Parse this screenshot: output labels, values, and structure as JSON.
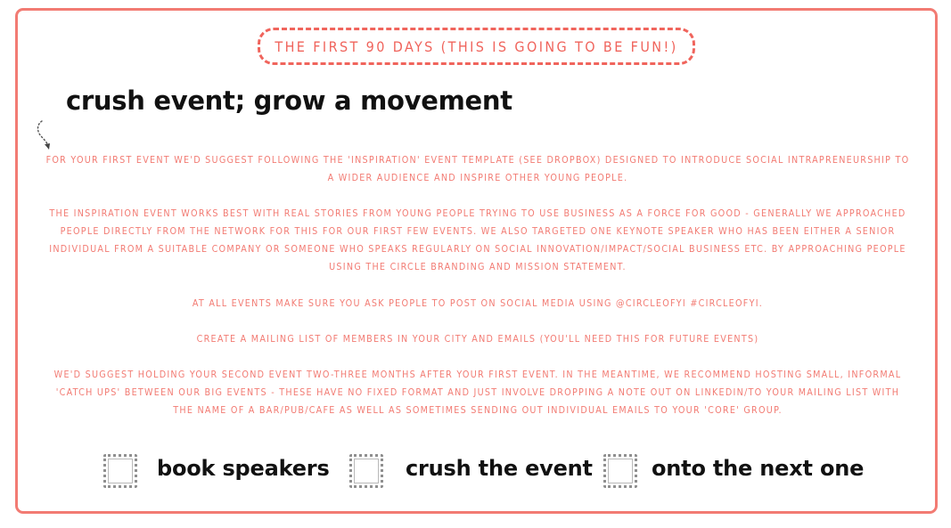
{
  "header": {
    "pill_text": "THE FIRST 90 DAYS (THIS IS GOING TO BE FUN!)",
    "heading": "crush event; grow a movement"
  },
  "paragraphs": [
    "FOR YOUR FIRST EVENT WE'D SUGGEST FOLLOWING THE 'INSPIRATION' EVENT TEMPLATE (SEE DROPBOX) DESIGNED TO INTRODUCE SOCIAL INTRAPRENEURSHIP TO A WIDER AUDIENCE AND INSPIRE OTHER YOUNG PEOPLE.",
    "THE INSPIRATION EVENT WORKS BEST WITH REAL STORIES FROM YOUNG PEOPLE TRYING TO USE BUSINESS AS A FORCE FOR GOOD - GENERALLY WE APPROACHED PEOPLE DIRECTLY FROM THE NETWORK FOR THIS FOR OUR FIRST FEW EVENTS. WE ALSO TARGETED ONE KEYNOTE SPEAKER WHO HAS BEEN EITHER A SENIOR INDIVIDUAL FROM A SUITABLE COMPANY OR SOMEONE WHO SPEAKS REGULARLY ON SOCIAL INNOVATION/IMPACT/SOCIAL BUSINESS ETC. BY APPROACHING PEOPLE USING THE CIRCLE BRANDING AND MISSION STATEMENT.",
    "AT ALL EVENTS MAKE SURE YOU ASK PEOPLE TO POST ON SOCIAL MEDIA USING @CIRCLEOFYI #CIRCLEOFYI.",
    "CREATE A MAILING LIST OF MEMBERS IN YOUR CITY AND EMAILS (YOU'LL NEED THIS FOR FUTURE EVENTS)",
    "WE'D SUGGEST HOLDING YOUR SECOND EVENT TWO-THREE MONTHS AFTER YOUR FIRST EVENT. IN THE MEANTIME, WE RECOMMEND HOSTING SMALL, INFORMAL 'CATCH UPS' BETWEEN OUR BIG EVENTS - THESE HAVE NO FIXED FORMAT AND JUST INVOLVE DROPPING A NOTE OUT ON LINKEDIN/TO YOUR MAILING LIST WITH THE NAME OF A BAR/PUB/CAFE AS WELL AS SOMETIMES SENDING OUT INDIVIDUAL EMAILS TO YOUR 'CORE' GROUP."
  ],
  "checklist": [
    {
      "label": "book speakers",
      "checked": false
    },
    {
      "label": "crush the event",
      "checked": false
    },
    {
      "label": "onto the next one",
      "checked": false
    }
  ],
  "colors": {
    "accent": "#f27b73",
    "pill": "#f0645c",
    "heading": "#111111",
    "checkbox_border": "#8f8f8f"
  },
  "icons": [
    "dotted-curved-arrow-icon",
    "checkbox-icon"
  ]
}
